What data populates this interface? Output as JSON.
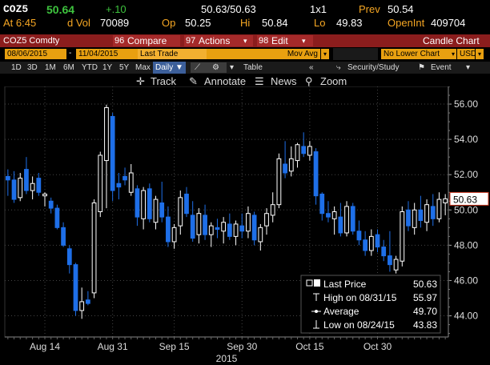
{
  "quote": {
    "ticker": "COZ5",
    "last": "50.64",
    "change": "+.10",
    "bid_ask": "50.63/50.63",
    "size": "1x1",
    "prev_label": "Prev",
    "prev": "50.54",
    "time_label": "At 6:45",
    "dvol_label": "d Vol",
    "dvol": "70089",
    "op_label": "Op",
    "op": "50.25",
    "hi_label": "Hi",
    "hi": "50.84",
    "lo_label": "Lo",
    "lo": "49.83",
    "openint_label": "OpenInt",
    "openint": "409704"
  },
  "toolbar": {
    "security": "COZ5 Comdty",
    "compare": "Compare",
    "actions": "Actions",
    "edit": "Edit",
    "chart_type": "Candle Chart"
  },
  "options": {
    "start_date": "08/06/2015",
    "end_date": "11/04/2015",
    "price_type": "Last Trade",
    "upper_study": "Mov Avg",
    "lower_study": "No Lower Chart",
    "currency": "USD"
  },
  "ranges": {
    "items": [
      "1D",
      "3D",
      "1M",
      "6M",
      "YTD",
      "1Y",
      "5Y",
      "Max"
    ],
    "period": "Daily",
    "table": "Table",
    "security_study": "Security/Study",
    "event": "Event"
  },
  "tools": {
    "track": "Track",
    "annotate": "Annotate",
    "news": "News",
    "zoom": "Zoom"
  },
  "colors": {
    "up": "#ffffff",
    "down": "#1e6fe8",
    "accent": "#f5a623",
    "price_change": "#3ec33e",
    "last_price_line": "#c8361f"
  },
  "legend": {
    "rows": [
      {
        "label": "Last Price",
        "value": "50.63",
        "icon": "candle-icon"
      },
      {
        "label": "High on 08/31/15",
        "value": "55.97",
        "icon": "high-marker-icon"
      },
      {
        "label": "Average",
        "value": "49.70",
        "icon": "average-line-icon"
      },
      {
        "label": "Low on 08/24/15",
        "value": "43.83",
        "icon": "low-marker-icon"
      }
    ]
  },
  "last_price_tag": "50.63",
  "chart_data": {
    "type": "candlestick",
    "xlabel": "2015",
    "x_tick_labels": [
      "Aug 14",
      "Aug 31",
      "Sep 15",
      "Sep 30",
      "Oct 15",
      "Oct 30"
    ],
    "x_tick_dates": [
      "2015-08-14",
      "2015-08-31",
      "2015-09-15",
      "2015-09-30",
      "2015-10-15",
      "2015-10-30"
    ],
    "y_ticks": [
      44,
      46,
      48,
      50,
      52,
      54,
      56
    ],
    "y_tick_labels": [
      "44.00",
      "46.00",
      "48.00",
      "50.00",
      "52.00",
      "54.00",
      "56.00"
    ],
    "ylim": [
      42.8,
      57.0
    ],
    "grid": true,
    "candles": [
      {
        "date": "2015-08-06",
        "open": 51.9,
        "high": 52.3,
        "low": 50.8,
        "close": 51.7
      },
      {
        "date": "2015-08-07",
        "open": 51.7,
        "high": 52.2,
        "low": 50.4,
        "close": 50.6
      },
      {
        "date": "2015-08-10",
        "open": 50.7,
        "high": 52.1,
        "low": 50.5,
        "close": 51.8
      },
      {
        "date": "2015-08-11",
        "open": 52.3,
        "high": 53.0,
        "low": 50.9,
        "close": 51.1
      },
      {
        "date": "2015-08-12",
        "open": 51.1,
        "high": 51.9,
        "low": 50.6,
        "close": 51.5
      },
      {
        "date": "2015-08-13",
        "open": 51.8,
        "high": 52.1,
        "low": 50.8,
        "close": 51.0
      },
      {
        "date": "2015-08-14",
        "open": 50.8,
        "high": 51.0,
        "low": 50.2,
        "close": 50.9
      },
      {
        "date": "2015-08-17",
        "open": 50.5,
        "high": 50.7,
        "low": 49.8,
        "close": 50.1
      },
      {
        "date": "2015-08-18",
        "open": 50.1,
        "high": 50.3,
        "low": 48.9,
        "close": 49.0
      },
      {
        "date": "2015-08-19",
        "open": 49.0,
        "high": 49.3,
        "low": 47.9,
        "close": 48.0
      },
      {
        "date": "2015-08-20",
        "open": 47.8,
        "high": 48.0,
        "low": 46.4,
        "close": 46.9
      },
      {
        "date": "2015-08-21",
        "open": 46.9,
        "high": 47.0,
        "low": 44.0,
        "close": 44.3
      },
      {
        "date": "2015-08-24",
        "open": 44.3,
        "high": 45.6,
        "low": 43.83,
        "close": 44.8
      },
      {
        "date": "2015-08-25",
        "open": 44.9,
        "high": 45.4,
        "low": 44.6,
        "close": 44.7
      },
      {
        "date": "2015-08-26",
        "open": 45.3,
        "high": 50.6,
        "low": 45.0,
        "close": 50.4
      },
      {
        "date": "2015-08-27",
        "open": 49.9,
        "high": 53.3,
        "low": 49.6,
        "close": 53.1
      },
      {
        "date": "2015-08-28",
        "open": 52.8,
        "high": 55.97,
        "low": 50.1,
        "close": 55.8
      },
      {
        "date": "2015-08-31",
        "open": 55.3,
        "high": 55.5,
        "low": 50.5,
        "close": 51.1
      },
      {
        "date": "2015-09-01",
        "open": 51.5,
        "high": 52.1,
        "low": 50.6,
        "close": 51.3
      },
      {
        "date": "2015-09-02",
        "open": 51.9,
        "high": 52.4,
        "low": 51.4,
        "close": 51.7
      },
      {
        "date": "2015-09-03",
        "open": 51.0,
        "high": 52.6,
        "low": 50.8,
        "close": 52.1
      },
      {
        "date": "2015-09-04",
        "open": 51.2,
        "high": 51.4,
        "low": 49.1,
        "close": 49.6
      },
      {
        "date": "2015-09-08",
        "open": 49.5,
        "high": 51.3,
        "low": 48.9,
        "close": 51.1
      },
      {
        "date": "2015-09-09",
        "open": 51.2,
        "high": 51.5,
        "low": 49.3,
        "close": 49.5
      },
      {
        "date": "2015-09-10",
        "open": 49.3,
        "high": 50.8,
        "low": 48.9,
        "close": 50.6
      },
      {
        "date": "2015-09-11",
        "open": 50.4,
        "high": 51.6,
        "low": 49.3,
        "close": 49.6
      },
      {
        "date": "2015-09-14",
        "open": 49.6,
        "high": 50.2,
        "low": 47.9,
        "close": 48.2
      },
      {
        "date": "2015-09-15",
        "open": 48.2,
        "high": 49.2,
        "low": 47.8,
        "close": 49.0
      },
      {
        "date": "2015-09-16",
        "open": 49.1,
        "high": 51.1,
        "low": 48.6,
        "close": 50.7
      },
      {
        "date": "2015-09-17",
        "open": 50.9,
        "high": 51.3,
        "low": 49.6,
        "close": 49.8
      },
      {
        "date": "2015-09-18",
        "open": 49.7,
        "high": 50.5,
        "low": 48.2,
        "close": 48.4
      },
      {
        "date": "2015-09-21",
        "open": 48.6,
        "high": 50.1,
        "low": 48.1,
        "close": 49.8
      },
      {
        "date": "2015-09-22",
        "open": 49.7,
        "high": 50.3,
        "low": 48.3,
        "close": 48.6
      },
      {
        "date": "2015-09-23",
        "open": 48.6,
        "high": 49.3,
        "low": 47.9,
        "close": 49.1
      },
      {
        "date": "2015-09-24",
        "open": 49.0,
        "high": 49.5,
        "low": 48.4,
        "close": 48.9
      },
      {
        "date": "2015-09-25",
        "open": 48.8,
        "high": 49.6,
        "low": 48.1,
        "close": 49.3
      },
      {
        "date": "2015-09-28",
        "open": 49.2,
        "high": 49.8,
        "low": 48.3,
        "close": 48.5
      },
      {
        "date": "2015-09-29",
        "open": 48.5,
        "high": 49.4,
        "low": 48.0,
        "close": 49.2
      },
      {
        "date": "2015-09-30",
        "open": 49.1,
        "high": 49.8,
        "low": 48.4,
        "close": 48.8
      },
      {
        "date": "2015-10-01",
        "open": 48.8,
        "high": 50.2,
        "low": 48.4,
        "close": 49.8
      },
      {
        "date": "2015-10-02",
        "open": 49.7,
        "high": 49.9,
        "low": 48.0,
        "close": 48.3
      },
      {
        "date": "2015-10-05",
        "open": 48.2,
        "high": 49.2,
        "low": 47.7,
        "close": 49.0
      },
      {
        "date": "2015-10-06",
        "open": 49.1,
        "high": 50.1,
        "low": 48.6,
        "close": 49.8
      },
      {
        "date": "2015-10-07",
        "open": 49.7,
        "high": 51.0,
        "low": 49.3,
        "close": 50.3
      },
      {
        "date": "2015-10-08",
        "open": 50.3,
        "high": 53.2,
        "low": 50.1,
        "close": 52.9
      },
      {
        "date": "2015-10-09",
        "open": 52.6,
        "high": 53.9,
        "low": 51.8,
        "close": 52.1
      },
      {
        "date": "2015-10-12",
        "open": 52.2,
        "high": 53.6,
        "low": 51.9,
        "close": 52.9
      },
      {
        "date": "2015-10-13",
        "open": 52.8,
        "high": 53.8,
        "low": 52.4,
        "close": 53.7
      },
      {
        "date": "2015-10-14",
        "open": 53.6,
        "high": 54.4,
        "low": 53.0,
        "close": 53.2
      },
      {
        "date": "2015-10-15",
        "open": 53.1,
        "high": 53.9,
        "low": 52.8,
        "close": 53.6
      },
      {
        "date": "2015-10-16",
        "open": 53.3,
        "high": 53.5,
        "low": 50.3,
        "close": 50.8
      },
      {
        "date": "2015-10-19",
        "open": 50.9,
        "high": 51.0,
        "low": 49.4,
        "close": 49.8
      },
      {
        "date": "2015-10-20",
        "open": 49.8,
        "high": 50.5,
        "low": 49.3,
        "close": 49.6
      },
      {
        "date": "2015-10-21",
        "open": 49.5,
        "high": 50.2,
        "low": 48.6,
        "close": 49.9
      },
      {
        "date": "2015-10-22",
        "open": 49.6,
        "high": 50.4,
        "low": 48.5,
        "close": 48.7
      },
      {
        "date": "2015-10-23",
        "open": 48.7,
        "high": 50.5,
        "low": 48.5,
        "close": 50.2
      },
      {
        "date": "2015-10-26",
        "open": 50.2,
        "high": 50.4,
        "low": 48.6,
        "close": 48.8
      },
      {
        "date": "2015-10-27",
        "open": 48.8,
        "high": 49.4,
        "low": 48.0,
        "close": 48.3
      },
      {
        "date": "2015-10-28",
        "open": 48.3,
        "high": 48.8,
        "low": 47.4,
        "close": 47.7
      },
      {
        "date": "2015-10-29",
        "open": 47.7,
        "high": 48.9,
        "low": 47.4,
        "close": 48.5
      },
      {
        "date": "2015-10-30",
        "open": 48.6,
        "high": 48.9,
        "low": 47.6,
        "close": 47.9
      },
      {
        "date": "2015-11-02",
        "open": 47.9,
        "high": 48.3,
        "low": 47.1,
        "close": 47.4
      },
      {
        "date": "2015-11-03",
        "open": 47.4,
        "high": 48.8,
        "low": 46.5,
        "close": 46.9
      },
      {
        "date": "2015-11-04",
        "open": 46.6,
        "high": 47.4,
        "low": 46.4,
        "close": 47.2
      },
      {
        "date": "2015-11-05",
        "open": 47.1,
        "high": 50.2,
        "low": 46.8,
        "close": 49.9
      },
      {
        "date": "2015-11-06",
        "open": 50.0,
        "high": 50.5,
        "low": 48.8,
        "close": 49.1
      },
      {
        "date": "2015-11-09",
        "open": 49.0,
        "high": 50.4,
        "low": 48.6,
        "close": 50.0
      },
      {
        "date": "2015-11-10",
        "open": 50.0,
        "high": 50.8,
        "low": 49.0,
        "close": 49.4
      },
      {
        "date": "2015-11-11",
        "open": 49.3,
        "high": 50.6,
        "low": 48.8,
        "close": 50.3
      },
      {
        "date": "2015-11-12",
        "open": 50.2,
        "high": 50.9,
        "low": 49.1,
        "close": 49.5
      },
      {
        "date": "2015-11-13",
        "open": 49.5,
        "high": 51.0,
        "low": 49.3,
        "close": 50.6
      },
      {
        "date": "2015-11-16",
        "open": 50.4,
        "high": 50.9,
        "low": 49.7,
        "close": 50.63
      }
    ]
  }
}
